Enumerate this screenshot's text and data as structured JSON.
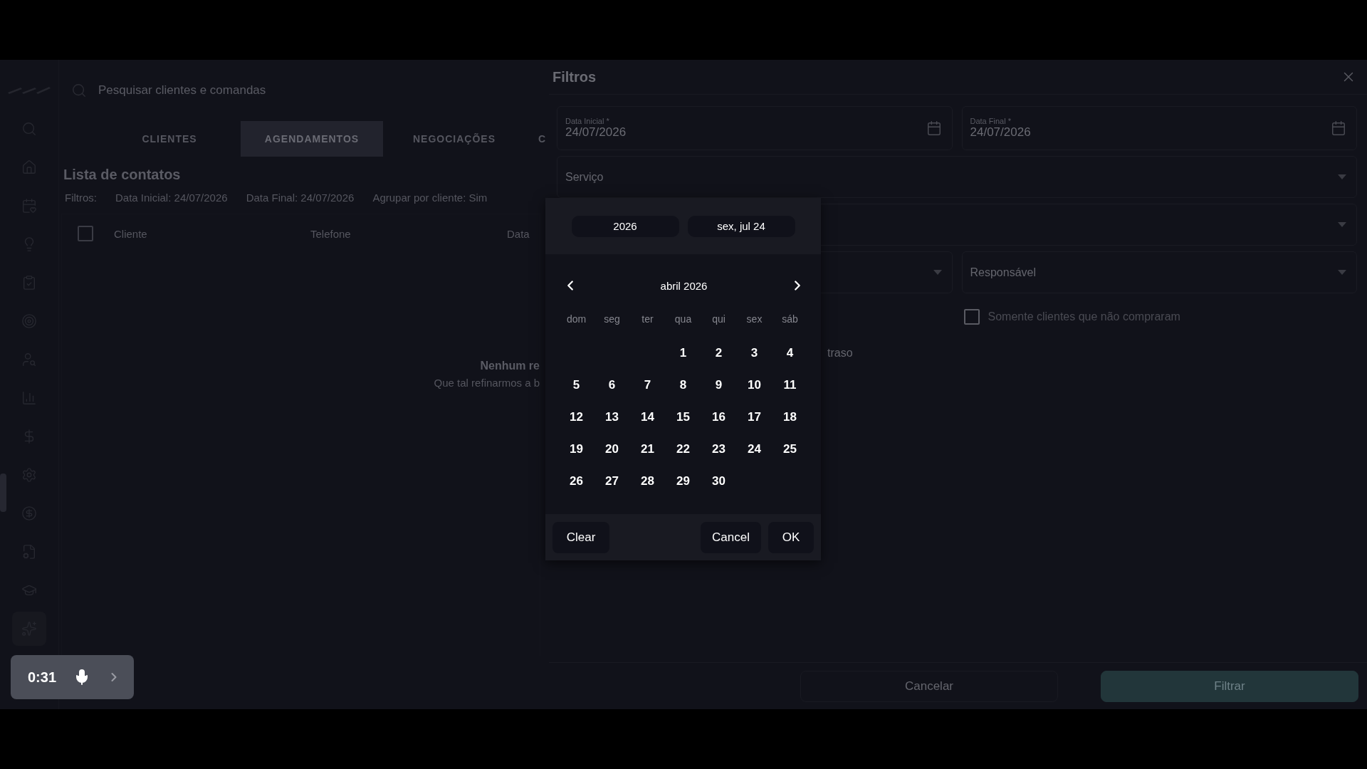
{
  "search": {
    "placeholder": "Pesquisar clientes e comandas"
  },
  "tabs": [
    {
      "label": "CLIENTES",
      "selected": false
    },
    {
      "label": "AGENDAMENTOS",
      "selected": true
    },
    {
      "label": "NEGOCIAÇÕES",
      "selected": false
    },
    {
      "label": "C",
      "selected": false
    }
  ],
  "list": {
    "title": "Lista de contatos",
    "filters_label": "Filtros:",
    "filters": [
      "Data Inicial: 24/07/2026",
      "Data Final: 24/07/2026",
      "Agrupar por cliente: Sim"
    ],
    "select_all_checked": false,
    "columns": [
      "Cliente",
      "Telefone",
      "Data"
    ],
    "empty_title": "Nenhum re",
    "empty_text": "Que tal refinarmos a b"
  },
  "filter_panel": {
    "title": "Filtros",
    "rows": [
      [
        {
          "kind": "date",
          "label": "Data Inicial *",
          "value": "24/07/2026"
        },
        {
          "kind": "date",
          "label": "Data Final *",
          "value": "24/07/2026"
        }
      ],
      [
        {
          "kind": "select",
          "label": "Serviço"
        }
      ],
      [
        {
          "kind": "select"
        }
      ],
      [
        {
          "kind": "select"
        },
        {
          "kind": "select",
          "label": "Responsável"
        }
      ],
      [
        {
          "kind": "empty"
        },
        {
          "kind": "checkbox",
          "label": "Somente clientes que não compraram",
          "checked": false
        }
      ],
      [
        {
          "kind": "text",
          "text": "traso"
        }
      ]
    ],
    "cancel": "Cancelar",
    "apply": "Filtrar"
  },
  "date_picker": {
    "year": "2026",
    "date": "sex, jul 24",
    "month": "abril 2026",
    "weekdays": [
      "dom",
      "seg",
      "ter",
      "qua",
      "qui",
      "sex",
      "sáb"
    ],
    "weeks": [
      {
        "kind": "first",
        "days": [
          "1",
          "2",
          "3",
          "4"
        ]
      },
      {
        "kind": "full",
        "days": [
          "5",
          "6",
          "7",
          "8",
          "9",
          "10",
          "11"
        ]
      },
      {
        "kind": "full",
        "days": [
          "12",
          "13",
          "14",
          "15",
          "16",
          "17",
          "18"
        ]
      },
      {
        "kind": "full",
        "days": [
          "19",
          "20",
          "21",
          "22",
          "23",
          "24",
          "25"
        ]
      },
      {
        "kind": "last",
        "days": [
          "26",
          "27",
          "28",
          "29",
          "30"
        ]
      }
    ],
    "actions": [
      "Clear",
      "Cancel",
      "OK"
    ]
  },
  "recorder": {
    "time": "0:31"
  }
}
